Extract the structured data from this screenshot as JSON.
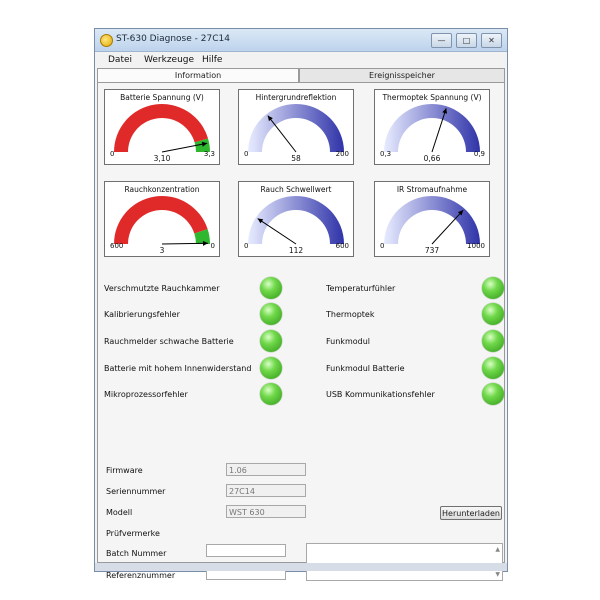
{
  "window": {
    "title": "ST-630 Diagnose - 27C14",
    "controls": {
      "minimize": "—",
      "maximize": "□",
      "close": "✕"
    }
  },
  "menu": {
    "items": [
      "Datei",
      "Werkzeuge",
      "Hilfe"
    ]
  },
  "tabs": [
    {
      "label": "Information",
      "active": true
    },
    {
      "label": "Ereignisspeicher",
      "active": false
    }
  ],
  "colors": {
    "red": "#e02a2a",
    "green": "#2fb82f",
    "blue_dark": "#2f33a8",
    "blue_light": "#e8ecff"
  },
  "gauges": [
    {
      "title": "Batterie Spannung (V)",
      "min_label": "0",
      "max_label": "3,3",
      "value_label": "3,10",
      "min": 0,
      "max": 3.3,
      "value": 3.1,
      "style": "red-green",
      "green_from": 3.0
    },
    {
      "title": "Hintergrundreflektion",
      "min_label": "0",
      "max_label": "200",
      "value_label": "58",
      "min": 0,
      "max": 200,
      "value": 58,
      "style": "blue"
    },
    {
      "title": "Thermoptek Spannung (V)",
      "min_label": "0,3",
      "max_label": "0,9",
      "value_label": "0,66",
      "min": 0.3,
      "max": 0.9,
      "value": 0.66,
      "style": "blue"
    },
    {
      "title": "Rauchkonzentration",
      "min_label": "600",
      "max_label": "0",
      "value_label": "3",
      "min": 600,
      "max": 0,
      "value": 3,
      "style": "red-green",
      "green_from": 60
    },
    {
      "title": "Rauch Schwellwert",
      "min_label": "0",
      "max_label": "600",
      "value_label": "112",
      "min": 0,
      "max": 600,
      "value": 112,
      "style": "blue"
    },
    {
      "title": "IR Stromaufnahme",
      "min_label": "0",
      "max_label": "1000",
      "value_label": "737",
      "min": 0,
      "max": 1000,
      "value": 737,
      "style": "blue"
    }
  ],
  "status_left": [
    "Verschmutzte Rauchkammer",
    "Kalibrierungsfehler",
    "Rauchmelder schwache Batterie",
    "Batterie mit hohem Innenwiderstand",
    "Mikroprozessorfehler"
  ],
  "status_right": [
    "Temperaturfühler",
    "Thermoptek",
    "Funkmodul",
    "Funkmodul Batterie",
    "USB Kommunikationsfehler"
  ],
  "info": {
    "firmware_label": "Firmware",
    "firmware_value": "1.06",
    "serial_label": "Seriennummer",
    "serial_value": "27C14",
    "model_label": "Modell",
    "model_value": "WST 630",
    "download_button": "Herunterladen",
    "pruef_label": "Prüfvermerke",
    "batch_label": "Batch Nummer",
    "batch_value": "",
    "ref_label": "Referenznummer",
    "ref_value": ""
  }
}
